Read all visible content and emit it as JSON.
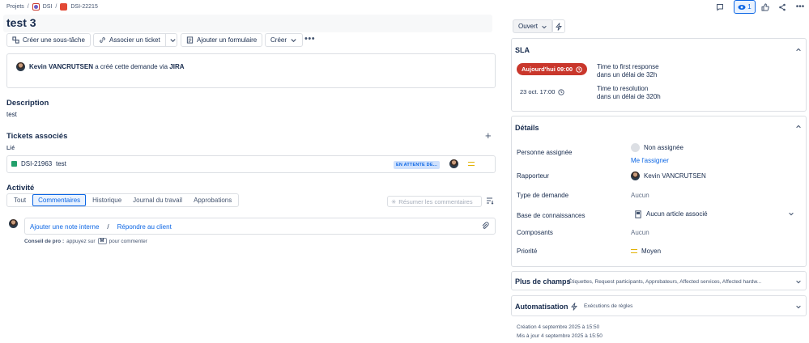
{
  "breadcrumb": {
    "items": [
      "Projets",
      "DSI",
      "DSI-22215"
    ],
    "separator": "/"
  },
  "issue": {
    "title": "test 3"
  },
  "actions": {
    "create_subtask": "Créer une sous-tâche",
    "link_ticket": "Associer un ticket",
    "add_form": "Ajouter un formulaire",
    "create": "Créer"
  },
  "creation": {
    "user": "Kevin VANCRUTSEN",
    "text": "a créé cette demande via",
    "via": "JIRA"
  },
  "description": {
    "heading": "Description",
    "text": "test"
  },
  "linked": {
    "heading": "Tickets associés",
    "relation": "Lié",
    "ticket": {
      "key": "DSI-21963",
      "summary": "test",
      "status": "EN ATTENTE DE..."
    }
  },
  "activity": {
    "heading": "Activité",
    "tabs": [
      "Tout",
      "Commentaires",
      "Historique",
      "Journal du travail",
      "Approbations"
    ],
    "active_tab": "Commentaires",
    "summarize": "Résumer les commentaires",
    "internal_note": "Ajouter une note interne",
    "sep": "/",
    "reply": "Répondre au client",
    "tip_label": "Conseil de pro :",
    "tip_before": "appuyez sur",
    "tip_key": "M",
    "tip_after": "pour commenter"
  },
  "header_right": {
    "watch_count": "1"
  },
  "status": {
    "label": "Ouvert"
  },
  "sla": {
    "heading": "SLA",
    "items": [
      {
        "time": "Aujourd'hui 09:00",
        "name": "Time to first response",
        "detail": "dans un délai de 32h"
      },
      {
        "time": "23 oct. 17:00",
        "name": "Time to resolution",
        "detail": "dans un délai de 320h"
      }
    ]
  },
  "details": {
    "heading": "Détails",
    "assignee_label": "Personne assignée",
    "assignee_value": "Non assignée",
    "assign_me": "Me l'assigner",
    "reporter_label": "Rapporteur",
    "reporter_value": "Kevin VANCRUTSEN",
    "request_type_label": "Type de demande",
    "request_type_value": "Aucun",
    "kb_label": "Base de connaissances",
    "kb_value": "Aucun article associé",
    "components_label": "Composants",
    "components_value": "Aucun",
    "priority_label": "Priorité",
    "priority_value": "Moyen"
  },
  "more_fields": {
    "heading": "Plus de champs",
    "summary": "Étiquettes, Request participants, Approbateurs, Affected services, Affected hardw..."
  },
  "automation": {
    "heading": "Automatisation",
    "summary": "Exécutions de règles"
  },
  "footer": {
    "created": "Création 4 septembre 2025 à 15:50",
    "updated": "Mis à jour 4 septembre 2025 à 15:50"
  },
  "colors": {
    "accent": "#0c66e4",
    "sla_breach": "#c9372c",
    "priority_medium": "#e2b203"
  }
}
